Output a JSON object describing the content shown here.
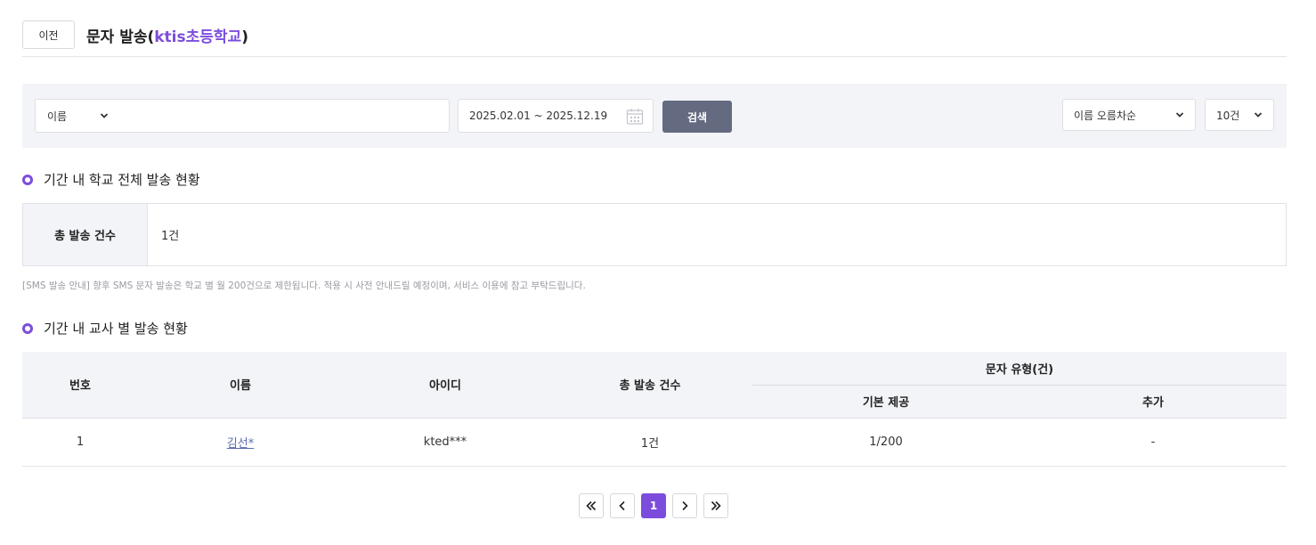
{
  "header": {
    "prev_label": "이전",
    "title_prefix": "문자 발송(",
    "school_name": "ktis초등학교",
    "title_suffix": ")"
  },
  "filter": {
    "search_type": "이름",
    "search_value": "",
    "date_range": "2025.02.01 ~ 2025.12.19",
    "search_button": "검색",
    "sort_selected": "이름 오름차순",
    "page_size_selected": "10건"
  },
  "school_section": {
    "title": "기간 내 학교 전체 발송 현황",
    "total_label": "총 발송 건수",
    "total_value": "1건"
  },
  "notice": "[SMS 발송 안내] 향후 SMS 문자 발송은 학교 별 월 200건으로 제한됩니다. 적용 시 사전 안내드릴 예정이며, 서비스 이용에 참고 부탁드립니다.",
  "teacher_section": {
    "title": "기간 내 교사 별 발송 현황",
    "columns": {
      "number": "번호",
      "name": "이름",
      "id": "아이디",
      "total": "총 발송 건수",
      "type_group": "문자 유형(건)",
      "basic": "기본 제공",
      "extra": "추가"
    },
    "rows": [
      {
        "number": "1",
        "name": "김선*",
        "id": "kted***",
        "total": "1건",
        "basic": "1/200",
        "extra": "-"
      }
    ]
  },
  "pagination": {
    "current_page": "1"
  },
  "colors": {
    "accent": "#7c4ddc",
    "search_button": "#646b80",
    "filter_bg": "#f3f4f8"
  },
  "icons": {
    "dropdown": "chevron-down-icon",
    "calendar": "calendar-icon",
    "first_page": "double-chevron-left-icon",
    "prev_page": "chevron-left-icon",
    "next_page": "chevron-right-icon",
    "last_page": "double-chevron-right-icon"
  }
}
